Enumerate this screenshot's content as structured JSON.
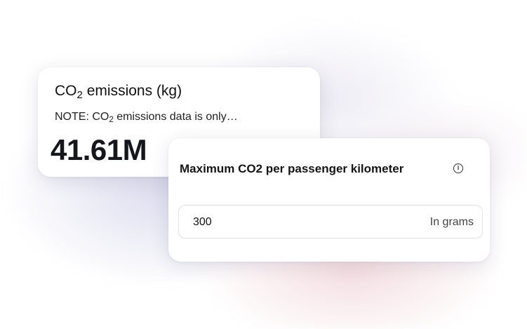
{
  "emissions_card": {
    "title_prefix": "CO",
    "title_subscript": "2",
    "title_suffix": " emissions (kg)",
    "note_prefix": "NOTE: CO",
    "note_subscript": "2",
    "note_suffix": " emissions data is only…",
    "value": "41.61M"
  },
  "max_co2_card": {
    "title": "Maximum CO2 per passenger kilometer",
    "info_icon": "info-icon",
    "info_glyph": "i",
    "input_value": "300",
    "input_suffix": "In grams"
  }
}
